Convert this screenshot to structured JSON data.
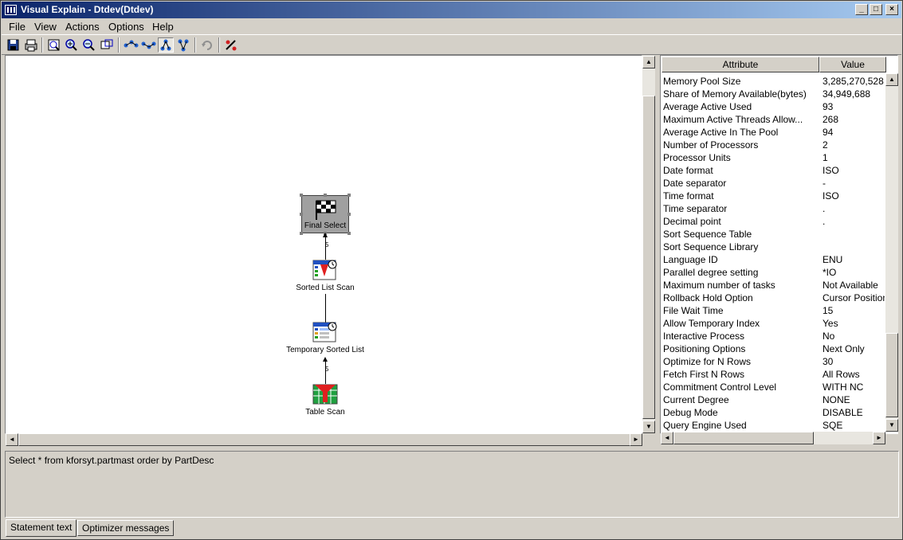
{
  "window": {
    "title": "Visual Explain - Dtdev(Dtdev)"
  },
  "menu": {
    "file": "File",
    "view": "View",
    "actions": "Actions",
    "options": "Options",
    "help": "Help"
  },
  "toolbar": {
    "icons": [
      "save-icon",
      "print-icon",
      "overview-icon",
      "zoom-in-icon",
      "zoom-out-icon",
      "zoom-fit-icon",
      "layout-left-right-icon",
      "layout-right-left-icon",
      "layout-top-down-icon",
      "layout-bottom-up-icon",
      "refresh-icon",
      "statistics-icon"
    ]
  },
  "graph": {
    "nodes": [
      {
        "label": "Final Select",
        "icon": "checkered-flag-icon"
      },
      {
        "label": "Sorted List Scan",
        "icon": "sorted-list-scan-icon"
      },
      {
        "label": "Temporary Sorted List",
        "icon": "temporary-sorted-list-icon"
      },
      {
        "label": "Table Scan",
        "icon": "table-scan-icon"
      }
    ],
    "edges": [
      {
        "label": "5"
      },
      {
        "label": ""
      },
      {
        "label": "5"
      }
    ]
  },
  "attributes": {
    "header_attribute": "Attribute",
    "header_value": "Value",
    "rows": [
      {
        "attribute": "Memory Pool Size",
        "value": "3,285,270,528"
      },
      {
        "attribute": "Share of Memory Available(bytes)",
        "value": "34,949,688"
      },
      {
        "attribute": "Average Active Used",
        "value": "93"
      },
      {
        "attribute": "Maximum Active Threads Allow...",
        "value": "268"
      },
      {
        "attribute": "Average Active In The Pool",
        "value": "94"
      },
      {
        "attribute": "Number of Processors",
        "value": "2"
      },
      {
        "attribute": "Processor Units",
        "value": "1"
      },
      {
        "attribute": "Date format",
        "value": "ISO"
      },
      {
        "attribute": "Date separator",
        "value": "-"
      },
      {
        "attribute": "Time format",
        "value": "ISO"
      },
      {
        "attribute": "Time separator",
        "value": "."
      },
      {
        "attribute": "Decimal point",
        "value": "."
      },
      {
        "attribute": "Sort Sequence Table",
        "value": ""
      },
      {
        "attribute": "Sort Sequence Library",
        "value": ""
      },
      {
        "attribute": "Language ID",
        "value": "ENU"
      },
      {
        "attribute": "Parallel degree setting",
        "value": "*IO"
      },
      {
        "attribute": "Maximum number of tasks",
        "value": "Not Available"
      },
      {
        "attribute": "Rollback Hold Option",
        "value": "Cursor Position"
      },
      {
        "attribute": "File Wait Time",
        "value": "15"
      },
      {
        "attribute": "Allow Temporary Index",
        "value": "Yes"
      },
      {
        "attribute": "Interactive Process",
        "value": "No"
      },
      {
        "attribute": "Positioning Options",
        "value": "Next Only"
      },
      {
        "attribute": "Optimize for N Rows",
        "value": "30"
      },
      {
        "attribute": "Fetch First N Rows",
        "value": "All Rows"
      },
      {
        "attribute": "Commitment Control Level",
        "value": "WITH NC"
      },
      {
        "attribute": "Current Degree",
        "value": "NONE"
      },
      {
        "attribute": "Debug Mode",
        "value": "DISABLE"
      },
      {
        "attribute": "Query Engine Used",
        "value": "SQE"
      }
    ]
  },
  "statement": {
    "text": "Select * from kforsyt.partmast order by PartDesc"
  },
  "tabs": {
    "statement_text": "Statement text",
    "optimizer_messages": "Optimizer messages"
  }
}
